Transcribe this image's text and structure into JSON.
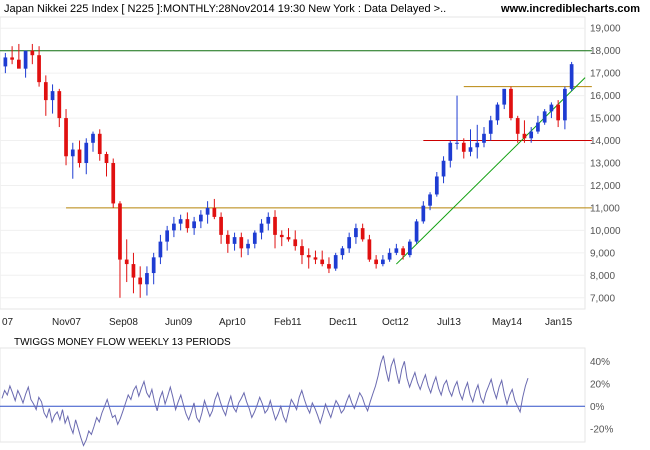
{
  "header": {
    "title": "Japan Nikkei 225 Index [ N225 ]:MONTHLY:28Nov2014 19:30 New York : Data Delayed >..",
    "site": "www.incrediblecharts.com"
  },
  "indicator": {
    "title": "TWIGGS MONEY FLOW WEEKLY 13 PERIODS"
  },
  "colors": {
    "up": "#1e3cd2",
    "down": "#e01010",
    "support": "#cc0000",
    "resistance": "#107010",
    "trend": "#10a010",
    "channel": "#b8860b",
    "twiggs": "#6a6ab0"
  },
  "chart_data": [
    {
      "type": "candlestick",
      "title": "Japan Nikkei 225 Index [ N225 ]:MONTHLY:28Nov2014 19:30 New York : Data Delayed >..",
      "x_ticks": [
        "07",
        "Nov07",
        "Sep08",
        "Jun09",
        "Apr10",
        "Feb11",
        "Dec11",
        "Oct12",
        "Jul13",
        "May14",
        "Jan15"
      ],
      "y_ticks": [
        "19,000",
        "18,000",
        "17,000",
        "16,000",
        "15,000",
        "14,000",
        "13,000",
        "12,000",
        "11,000",
        "10,000",
        "9,000",
        "8,000",
        "7,000"
      ],
      "ylim": [
        6500,
        19500
      ],
      "candles": [
        [
          17300,
          17900,
          17000,
          17700
        ],
        [
          17700,
          18200,
          17400,
          17600
        ],
        [
          17600,
          18300,
          17300,
          17200
        ],
        [
          17200,
          17900,
          16800,
          18000
        ],
        [
          18000,
          18300,
          17400,
          17800
        ],
        [
          17800,
          18200,
          16400,
          16600
        ],
        [
          16600,
          16900,
          15100,
          15800
        ],
        [
          15800,
          16500,
          15200,
          16200
        ],
        [
          16200,
          16300,
          14600,
          15000
        ],
        [
          15000,
          15400,
          12900,
          13300
        ],
        [
          13300,
          13900,
          12300,
          13600
        ],
        [
          13600,
          14000,
          12800,
          13000
        ],
        [
          13000,
          14100,
          12500,
          13900
        ],
        [
          13900,
          14400,
          13500,
          14300
        ],
        [
          14300,
          14500,
          13100,
          13400
        ],
        [
          13400,
          13500,
          12400,
          13000
        ],
        [
          13000,
          13200,
          11000,
          11200
        ],
        [
          11200,
          11300,
          7000,
          8700
        ],
        [
          8700,
          9600,
          7700,
          8500
        ],
        [
          8500,
          9000,
          7200,
          7900
        ],
        [
          7900,
          8400,
          7000,
          7600
        ],
        [
          7600,
          8400,
          7100,
          8100
        ],
        [
          8100,
          9000,
          7600,
          8800
        ],
        [
          8800,
          9800,
          8500,
          9500
        ],
        [
          9500,
          10200,
          9100,
          10000
        ],
        [
          10000,
          10600,
          9700,
          10300
        ],
        [
          10300,
          10700,
          10000,
          10500
        ],
        [
          10500,
          10800,
          9900,
          10100
        ],
        [
          10100,
          10600,
          9800,
          10400
        ],
        [
          10400,
          10900,
          10100,
          10700
        ],
        [
          10700,
          11300,
          10300,
          11000
        ],
        [
          11000,
          11400,
          10500,
          10600
        ],
        [
          10600,
          10800,
          9400,
          9800
        ],
        [
          9800,
          10000,
          9000,
          9400
        ],
        [
          9400,
          9900,
          9100,
          9700
        ],
        [
          9700,
          9900,
          8800,
          9200
        ],
        [
          9200,
          9600,
          8900,
          9400
        ],
        [
          9400,
          10000,
          9200,
          9900
        ],
        [
          9900,
          10500,
          9600,
          10300
        ],
        [
          10300,
          10800,
          10000,
          10600
        ],
        [
          10600,
          10900,
          9200,
          9800
        ],
        [
          9800,
          10000,
          9300,
          9700
        ],
        [
          9700,
          10100,
          9500,
          9600
        ],
        [
          9600,
          10000,
          9100,
          9300
        ],
        [
          9300,
          9600,
          8500,
          8900
        ],
        [
          8900,
          9200,
          8300,
          8800
        ],
        [
          8800,
          9100,
          8500,
          8700
        ],
        [
          8700,
          9100,
          8400,
          8500
        ],
        [
          8500,
          8800,
          8100,
          8300
        ],
        [
          8300,
          9000,
          8200,
          8900
        ],
        [
          8900,
          9300,
          8700,
          9200
        ],
        [
          9200,
          9900,
          9000,
          9700
        ],
        [
          9700,
          10300,
          9400,
          10100
        ],
        [
          10100,
          10300,
          9500,
          9600
        ],
        [
          9600,
          9800,
          8600,
          8700
        ],
        [
          8700,
          8900,
          8300,
          8500
        ],
        [
          8500,
          8900,
          8400,
          8700
        ],
        [
          8700,
          9200,
          8600,
          9000
        ],
        [
          9000,
          9400,
          8900,
          9200
        ],
        [
          9200,
          9300,
          8700,
          8900
        ],
        [
          8900,
          9600,
          8800,
          9500
        ],
        [
          9500,
          10500,
          9400,
          10400
        ],
        [
          10400,
          11300,
          10300,
          11100
        ],
        [
          11100,
          11700,
          10900,
          11600
        ],
        [
          11600,
          12600,
          11500,
          12400
        ],
        [
          12400,
          13300,
          12100,
          13100
        ],
        [
          13100,
          14000,
          12800,
          13900
        ],
        [
          13900,
          16000,
          13600,
          13900
        ],
        [
          13900,
          14100,
          13200,
          13500
        ],
        [
          13500,
          14500,
          13300,
          13700
        ],
        [
          13700,
          14700,
          13200,
          13900
        ],
        [
          13900,
          14600,
          13700,
          14300
        ],
        [
          14300,
          15100,
          14000,
          14900
        ],
        [
          14900,
          15700,
          14700,
          15600
        ],
        [
          15600,
          16300,
          15400,
          16300
        ],
        [
          16300,
          16400,
          14900,
          15000
        ],
        [
          15000,
          15100,
          13900,
          14300
        ],
        [
          14300,
          14900,
          13900,
          14100
        ],
        [
          14100,
          14600,
          13900,
          14400
        ],
        [
          14400,
          15100,
          14300,
          14800
        ],
        [
          14800,
          15400,
          14700,
          15300
        ],
        [
          15300,
          15700,
          15000,
          15600
        ],
        [
          15600,
          15800,
          14600,
          14900
        ],
        [
          14900,
          16400,
          14500,
          16300
        ],
        [
          16300,
          17500,
          16200,
          17400
        ]
      ],
      "lines": [
        {
          "name": "resistance",
          "x": [
            0,
            87
          ],
          "y": [
            18000,
            18000
          ]
        },
        {
          "name": "support",
          "x": [
            62,
            87
          ],
          "y": [
            14000,
            14000
          ]
        },
        {
          "name": "channel-upper",
          "x": [
            68,
            87
          ],
          "y": [
            16400,
            16400
          ]
        },
        {
          "name": "channel-lower",
          "x": [
            9,
            87
          ],
          "y": [
            11000,
            11000
          ]
        },
        {
          "name": "trendline",
          "x": [
            58,
            86
          ],
          "y": [
            8500,
            16800
          ]
        }
      ]
    },
    {
      "type": "line",
      "title": "TWIGGS MONEY FLOW WEEKLY 13 PERIODS",
      "y_ticks": [
        "40%",
        "20%",
        "0%",
        "-20%"
      ],
      "ylim": [
        -30,
        50
      ],
      "series": [
        {
          "values": [
            7,
            14,
            10,
            18,
            12,
            5,
            14,
            9,
            3,
            11,
            17,
            6,
            2,
            -3,
            8,
            4,
            -6,
            -10,
            -2,
            -14,
            -8,
            -5,
            -12,
            -3,
            -15,
            -9,
            -18,
            -24,
            -12,
            -20,
            -28,
            -35,
            -30,
            -22,
            -25,
            -18,
            -10,
            -14,
            -6,
            0,
            6,
            -2,
            -10,
            -8,
            -16,
            -11,
            -4,
            3,
            10,
            6,
            14,
            18,
            9,
            16,
            22,
            12,
            8,
            15,
            4,
            -4,
            7,
            13,
            2,
            9,
            17,
            8,
            -3,
            4,
            10,
            1,
            -7,
            -12,
            -5,
            3,
            -10,
            -14,
            -6,
            5,
            -2,
            -9,
            -4,
            6,
            12,
            4,
            -3,
            -8,
            2,
            9,
            -1,
            -5,
            3,
            7,
            12,
            4,
            -2,
            -10,
            -5,
            1,
            8,
            2,
            -6,
            -3,
            5,
            -4,
            -12,
            -7,
            0,
            -9,
            -14,
            -4,
            6,
            2,
            -3,
            8,
            14,
            6,
            -1,
            -6,
            3,
            -2,
            -8,
            -15,
            -7,
            2,
            -4,
            -10,
            -2,
            5,
            1,
            -6,
            -3,
            4,
            10,
            3,
            -2,
            5,
            12,
            8,
            1,
            -4,
            4,
            11,
            18,
            27,
            38,
            45,
            32,
            22,
            36,
            42,
            30,
            20,
            33,
            40,
            25,
            17,
            24,
            30,
            21,
            15,
            22,
            28,
            18,
            12,
            20,
            26,
            16,
            10,
            19,
            23,
            14,
            9,
            17,
            22,
            12,
            6,
            15,
            21,
            10,
            4,
            13,
            19,
            8,
            3,
            12,
            18,
            24,
            14,
            7,
            17,
            23,
            11,
            2,
            10,
            15,
            5,
            0,
            -5,
            8,
            18,
            25
          ]
        }
      ]
    }
  ]
}
